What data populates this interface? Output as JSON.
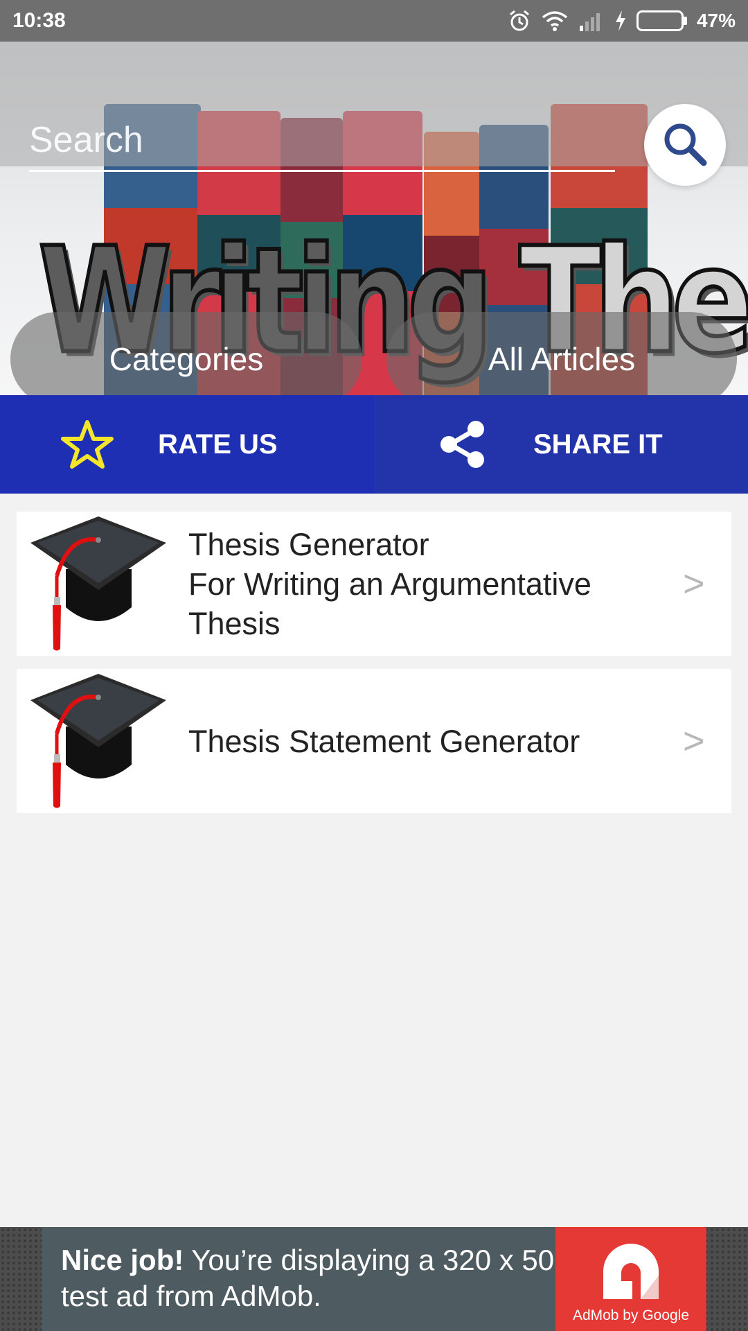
{
  "status_bar": {
    "time": "10:38",
    "battery": "47%",
    "battery_level": 0.47,
    "icons": [
      "alarm-icon",
      "wifi-icon",
      "signal-icon",
      "charging-icon",
      "battery-icon"
    ]
  },
  "hero": {
    "banner_word1": "Writing",
    "banner_word2": "Thesis",
    "search": {
      "placeholder": "Search",
      "value": ""
    },
    "categories_label": "Categories",
    "all_articles_label": "All Articles"
  },
  "actions": {
    "rate_label": "RATE US",
    "share_label": "SHARE IT"
  },
  "list": {
    "items": [
      {
        "title": "Thesis Generator\nFor Writing an Argumentative\nThesis",
        "icon": "graduation-cap-icon"
      },
      {
        "title": "Thesis Statement Generator",
        "icon": "graduation-cap-icon"
      }
    ],
    "chevron": ">"
  },
  "ad": {
    "bold": "Nice job!",
    "text": " You’re displaying a 320 x 50 test ad from AdMob.",
    "caption": "AdMob by Google"
  },
  "colors": {
    "action_rate_bg": "#1e2fb4",
    "action_share_bg": "#2333aa",
    "star": "#f5e62a",
    "search_icon": "#2e4a8c",
    "ad_red": "#e53935"
  }
}
